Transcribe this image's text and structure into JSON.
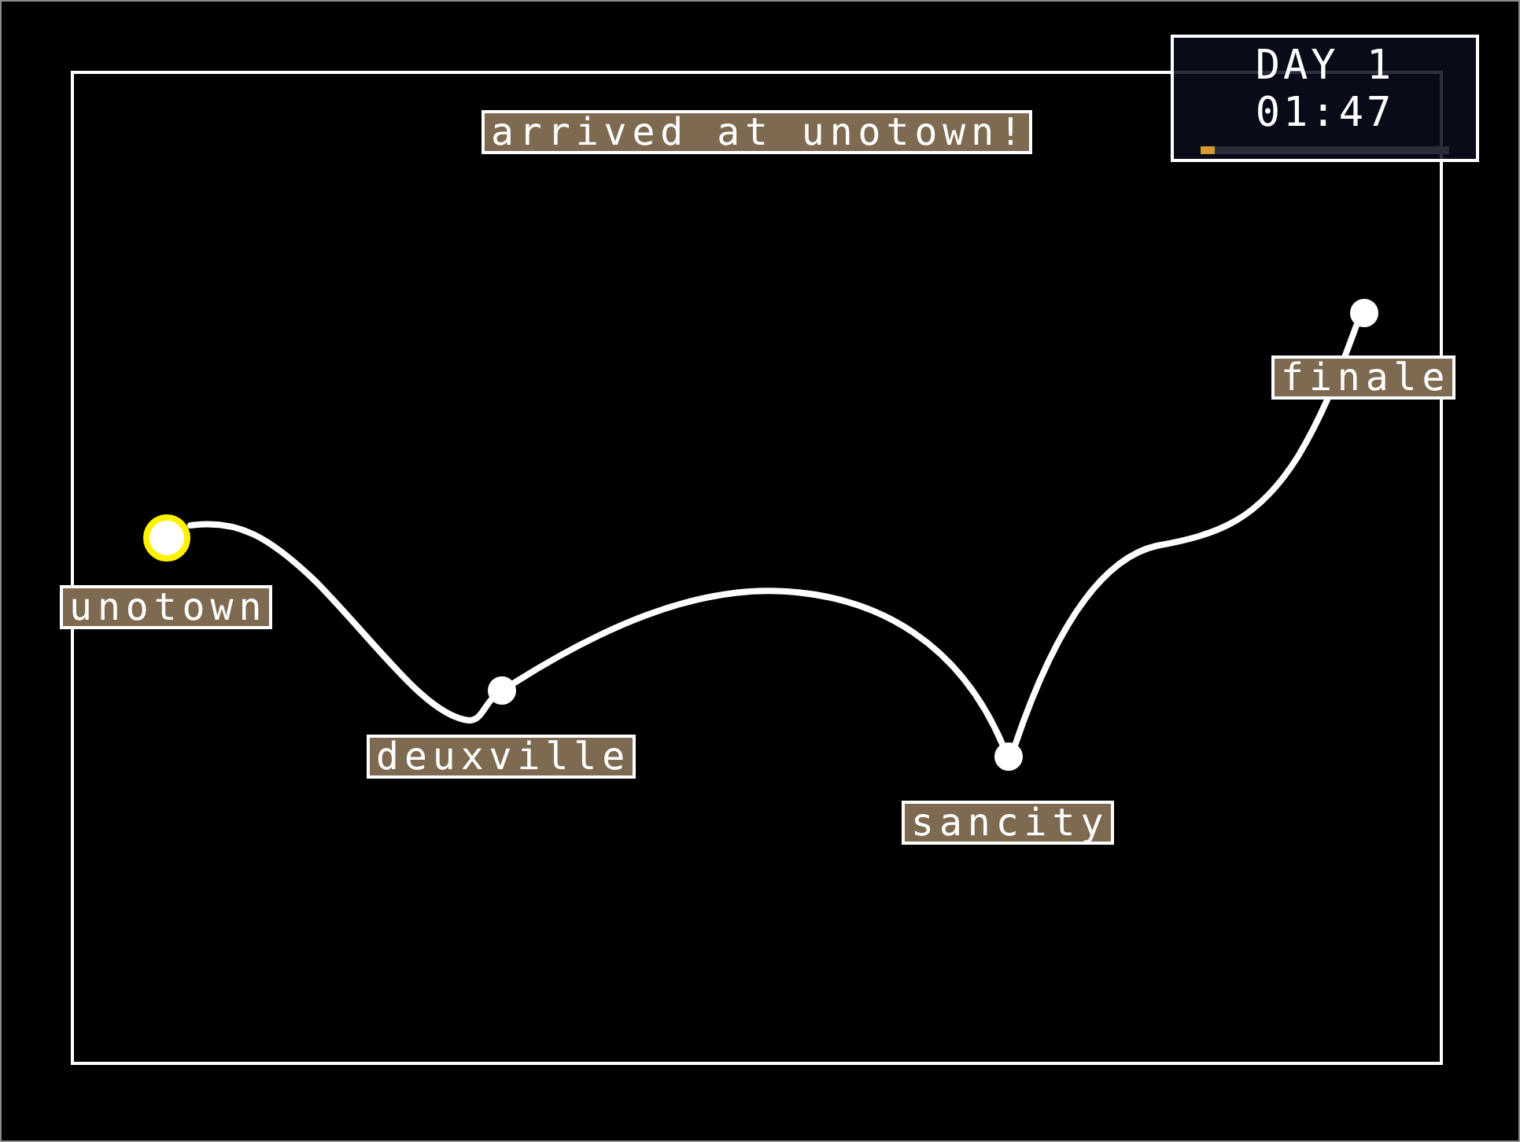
{
  "hud": {
    "day": "DAY 1",
    "time": "01:47",
    "level": 0.06
  },
  "message": "arrived at unotown!",
  "towns": [
    {
      "name": "unotown",
      "current": true
    },
    {
      "name": "deuxville",
      "current": false
    },
    {
      "name": "sancity",
      "current": false
    },
    {
      "name": "finale",
      "current": false
    }
  ]
}
